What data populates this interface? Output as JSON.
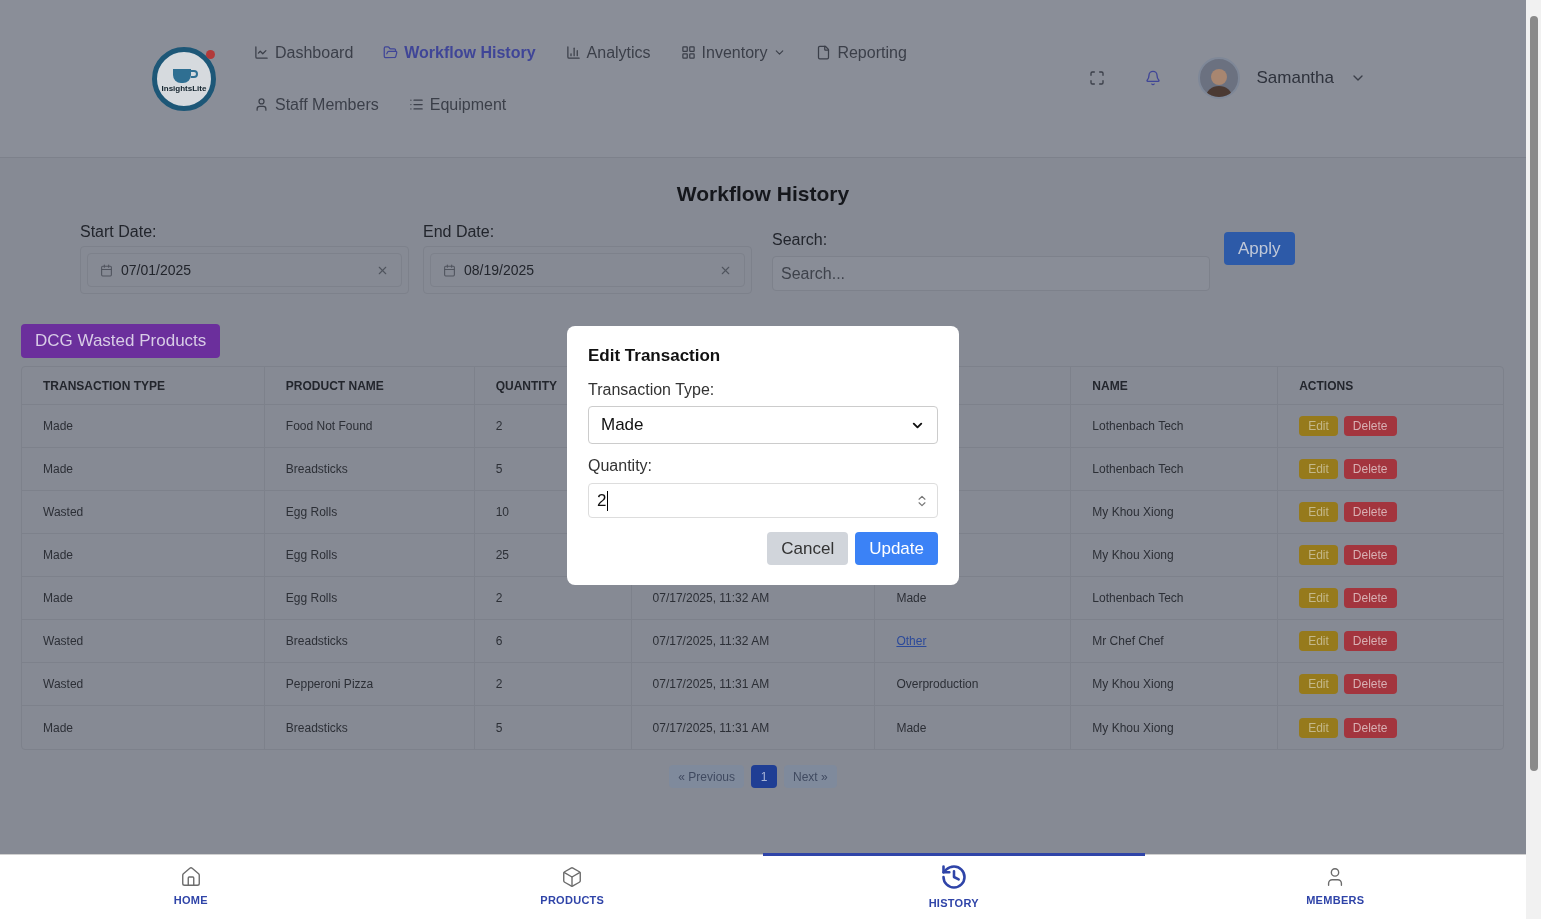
{
  "header": {
    "logo_text": "InsightsLite",
    "nav": [
      {
        "label": "Dashboard",
        "selected": false,
        "dropdown": false
      },
      {
        "label": "Workflow History",
        "selected": true,
        "dropdown": false
      },
      {
        "label": "Analytics",
        "selected": false,
        "dropdown": false
      },
      {
        "label": "Inventory",
        "selected": false,
        "dropdown": true
      },
      {
        "label": "Reporting",
        "selected": false,
        "dropdown": false
      },
      {
        "label": "Staff Members",
        "selected": false,
        "dropdown": false
      },
      {
        "label": "Equipment",
        "selected": false,
        "dropdown": false
      }
    ],
    "user": {
      "name": "Samantha"
    }
  },
  "title": "Workflow History",
  "filters": {
    "start": {
      "label": "Start Date:",
      "value": "07/01/2025"
    },
    "end": {
      "label": "End Date:",
      "value": "08/19/2025"
    },
    "search": {
      "label": "Search:",
      "placeholder": "Search..."
    },
    "apply": "Apply"
  },
  "category_button": "DCG Wasted Products",
  "table": {
    "columns": [
      "TRANSACTION TYPE",
      "PRODUCT NAME",
      "QUANTITY",
      null,
      null,
      "NAME",
      "ACTIONS"
    ],
    "rows": [
      {
        "type": "Made",
        "product": "Food Not Found",
        "quantity": "2",
        "name": "Lothenbach Tech",
        "edit": "Edit",
        "delete": "Delete"
      },
      {
        "type": "Made",
        "product": "Breadsticks",
        "quantity": "5",
        "name": "Lothenbach Tech",
        "edit": "Edit",
        "delete": "Delete"
      },
      {
        "type": "Wasted",
        "product": "Egg Rolls",
        "quantity": "10",
        "name": "My Khou Xiong",
        "edit": "Edit",
        "delete": "Delete"
      },
      {
        "type": "Made",
        "product": "Egg Rolls",
        "quantity": "25",
        "name": "My Khou Xiong",
        "edit": "Edit",
        "delete": "Delete"
      },
      {
        "type": "Made",
        "product": "Egg Rolls",
        "quantity": "2",
        "column_4": "07/17/2025, 11:32 AM",
        "column_5": {
          "text": "Made",
          "kind": "text"
        },
        "name": "Lothenbach Tech",
        "edit": "Edit",
        "delete": "Delete"
      },
      {
        "type": "Wasted",
        "product": "Breadsticks",
        "quantity": "6",
        "column_4": "07/17/2025, 11:32 AM",
        "column_5": {
          "text": "Other",
          "kind": "link"
        },
        "name": "Mr Chef Chef",
        "edit": "Edit",
        "delete": "Delete"
      },
      {
        "type": "Wasted",
        "product": "Pepperoni Pizza",
        "quantity": "2",
        "column_4": "07/17/2025, 11:31 AM",
        "column_5": {
          "text": "Overproduction",
          "kind": "text"
        },
        "name": "My Khou Xiong",
        "edit": "Edit",
        "delete": "Delete"
      },
      {
        "type": "Made",
        "product": "Breadsticks",
        "quantity": "5",
        "column_4": "07/17/2025, 11:31 AM",
        "column_5": {
          "text": "Made",
          "kind": "text"
        },
        "name": "My Khou Xiong",
        "edit": "Edit",
        "delete": "Delete"
      }
    ]
  },
  "pagination": {
    "previous": "« Previous",
    "pages": [
      {
        "label": "1",
        "selected": true
      }
    ],
    "next": "Next »"
  },
  "modal": {
    "title": "Edit Transaction",
    "type_label": "Transaction Type:",
    "type_value": "Made",
    "quantity_label": "Quantity:",
    "quantity_value": "2",
    "cancel": "Cancel",
    "update": "Update"
  },
  "bottom_nav": [
    {
      "label": "HOME",
      "selected": false
    },
    {
      "label": "PRODUCTS",
      "selected": false
    },
    {
      "label": "HISTORY",
      "selected": true
    },
    {
      "label": "MEMBERS",
      "selected": false
    }
  ]
}
